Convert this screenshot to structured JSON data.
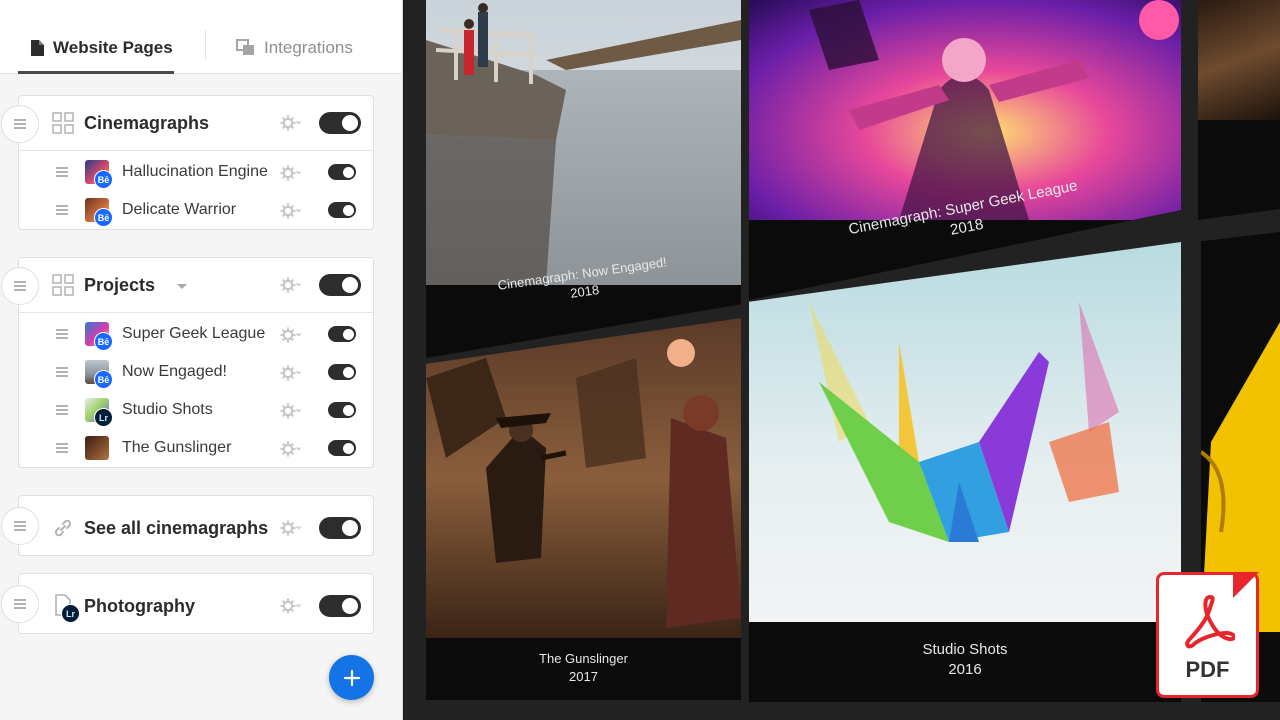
{
  "tabs": {
    "pages": "Website Pages",
    "integrations": "Integrations"
  },
  "sections": [
    {
      "title": "Cinemagraphs",
      "items": [
        {
          "label": "Hallucination Engine",
          "badge": "Bē"
        },
        {
          "label": "Delicate Warrior",
          "badge": "Bē"
        }
      ]
    },
    {
      "title": "Projects",
      "items": [
        {
          "label": "Super Geek League",
          "badge": "Bē"
        },
        {
          "label": "Now Engaged!",
          "badge": "Bē"
        },
        {
          "label": "Studio Shots",
          "badge": "Lr"
        },
        {
          "label": "The Gunslinger",
          "badge": ""
        }
      ]
    },
    {
      "title": "See all cinemagraphs"
    },
    {
      "title": "Photography",
      "badge": "Lr"
    }
  ],
  "add_button": "+",
  "gallery": [
    {
      "title": "Cinemagraph: Now Engaged!",
      "year": "2018"
    },
    {
      "title": "Cinemagraph: Super Geek League",
      "year": "2018"
    },
    {
      "title": "The Gunslinger",
      "year": "2017"
    },
    {
      "title": "Studio Shots",
      "year": "2016"
    }
  ],
  "pdf_label": "PDF",
  "colors": {
    "accent_blue": "#1473e6",
    "behance_blue": "#1769ff",
    "lightroom_navy": "#001e36",
    "pdf_red": "#e8252a"
  }
}
